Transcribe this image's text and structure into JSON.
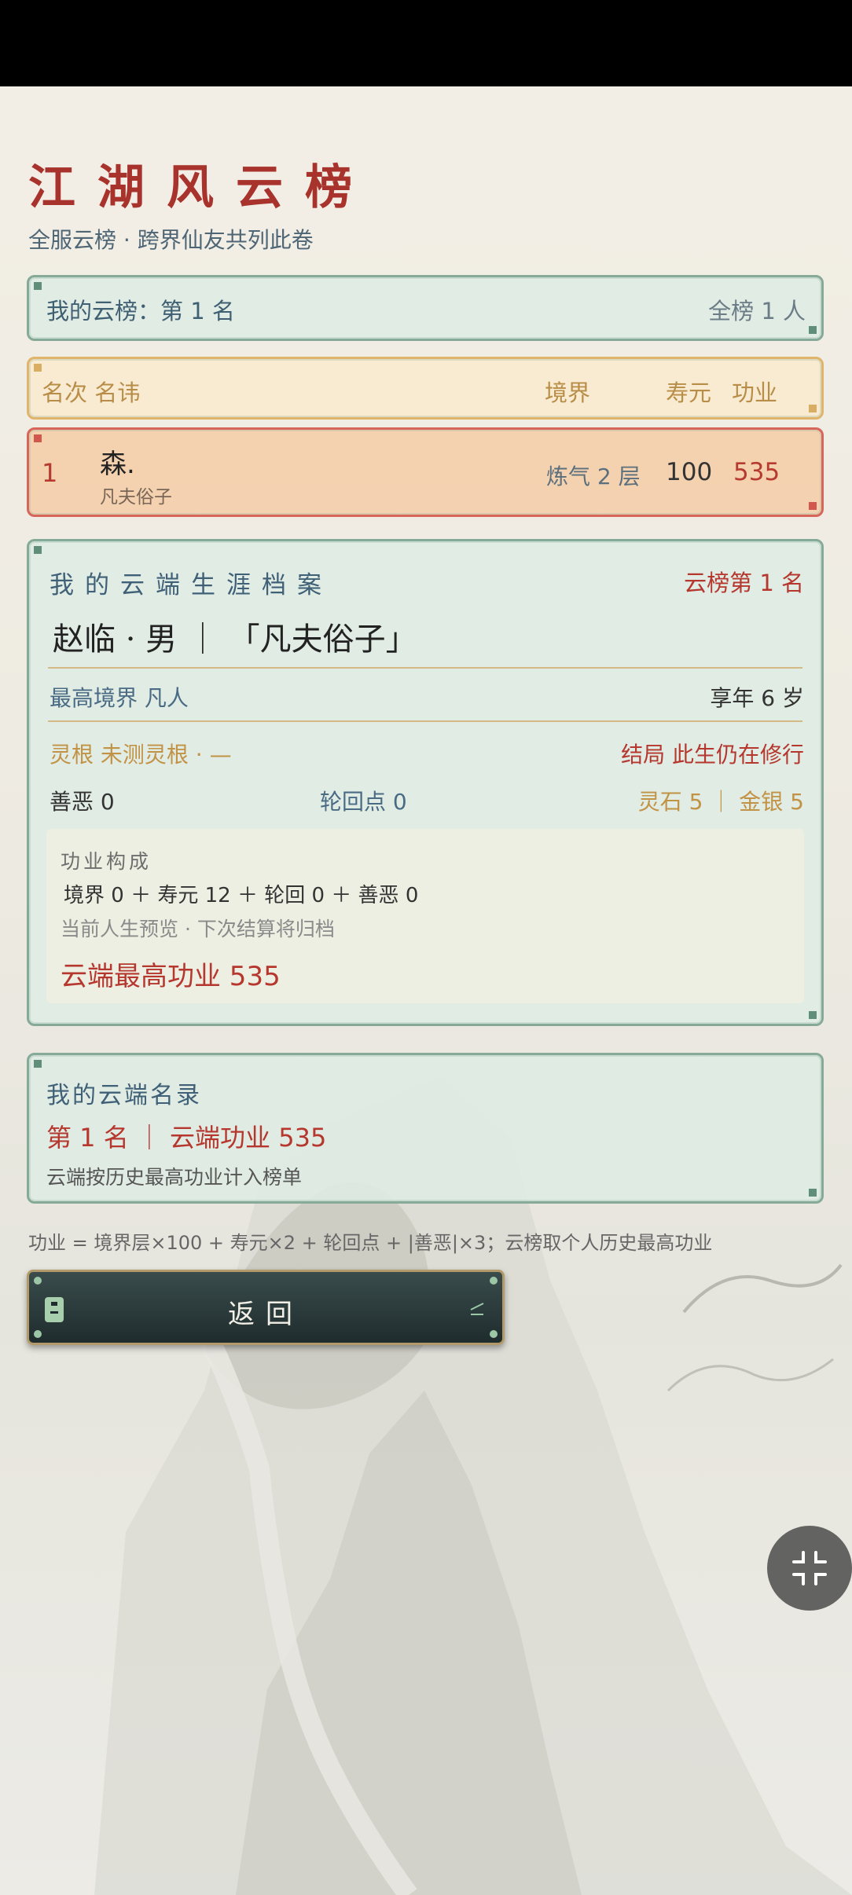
{
  "title": "江湖风云榜",
  "subtitle": "全服云榜 · 跨界仙友共列此卷",
  "my_rank": {
    "label": "我的云榜：第 1 名",
    "total": "全榜 1 人"
  },
  "table": {
    "headers": {
      "rank_name": "名次 名讳",
      "realm": "境界",
      "lifespan": "寿元",
      "merit": "功业"
    },
    "rows": [
      {
        "rank": "1",
        "name": "森.",
        "title": "凡夫俗子",
        "realm": "炼气 2 层",
        "lifespan": "100",
        "merit": "535"
      }
    ]
  },
  "archive": {
    "heading": "我的云端生涯档案",
    "rank": "云榜第 1 名",
    "identity": "赵临 · 男 ｜ 「凡夫俗子」",
    "highest_realm": "最高境界  凡人",
    "age": "享年  6 岁",
    "spirit_root": "灵根  未测灵根 · —",
    "ending": "结局  此生仍在修行",
    "good_evil": "善恶  0",
    "reincarnation": "轮回点  0",
    "currency": "灵石  5 ｜ 金银 5",
    "merit_box": {
      "title": "功业构成",
      "formula": "境界 0 ＋ 寿元 12 ＋ 轮回 0 ＋ 善恶 0",
      "note": "当前人生预览 · 下次结算将归档",
      "best": "云端最高功业  535"
    }
  },
  "cloud_record": {
    "title": "我的云端名录",
    "rank": "第 1 名 ｜ 云端功业 535",
    "note": "云端按历史最高功业计入榜单"
  },
  "footnote": "功业 = 境界层×100 + 寿元×2 + 轮回点 + |善恶|×3；云榜取个人历史最高功业",
  "back_button": "返回",
  "colors": {
    "accent_red": "#b5372e",
    "panel_green": "#86aa98",
    "header_gold": "#e0b46a",
    "row_coral": "#d8655a"
  },
  "icons": {
    "fab": "collapse-icon",
    "back_left": "scroll-icon"
  }
}
